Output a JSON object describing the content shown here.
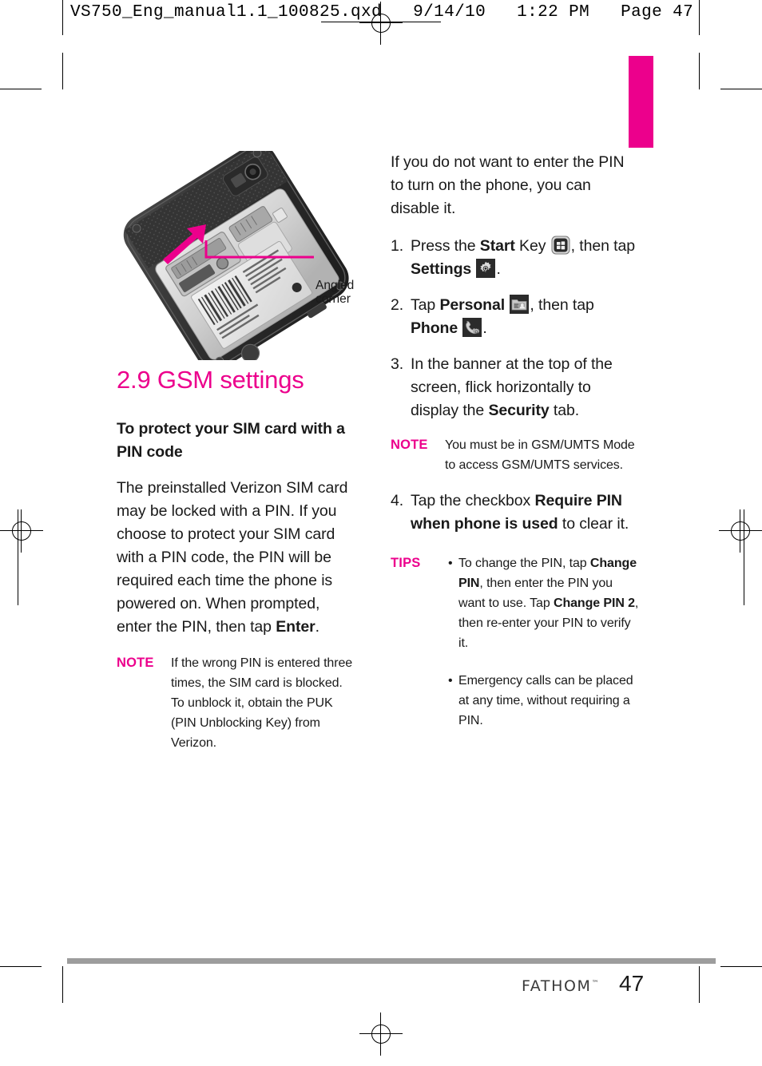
{
  "print_header": {
    "text": "VS750_Eng_manual1.1_100825.qxd   9/14/10   1:22 PM   Page 47"
  },
  "colors": {
    "accent": "#EC008C",
    "text": "#1A1A1A",
    "rule": "#9D9D9D"
  },
  "figure": {
    "alt_name": "phone-back-cover-removed-sim-slot",
    "callout_line1": "Angled",
    "callout_line2": "corner"
  },
  "left_column": {
    "section_title": "2.9 GSM settings",
    "sub_title": "To protect your SIM card with a PIN code",
    "paragraph_parts": {
      "p1_a": "The preinstalled Verizon SIM card may be locked with a PIN. If you choose to protect your SIM card with a PIN code, the PIN will be required each time the phone is powered on. When prompted, enter the PIN, then tap ",
      "p1_bold": "Enter",
      "p1_b": "."
    },
    "note": {
      "tag": "NOTE",
      "text": "If the wrong PIN is entered three times, the SIM card is blocked. To unblock it, obtain the PUK (PIN Unblocking Key) from Verizon."
    }
  },
  "right_column": {
    "intro": "If you do not want to enter the PIN to turn on the phone, you can disable it.",
    "steps": [
      {
        "num": "1.",
        "a": "Press the ",
        "bold1": "Start",
        "b": " Key ",
        "icon1": "start-key-icon",
        "c": ", then tap ",
        "bold2": "Settings",
        "icon2": "settings-gear-icon",
        "d": "."
      },
      {
        "num": "2.",
        "a": "Tap ",
        "bold1": "Personal",
        "icon1": "personal-folder-icon",
        "b": ", then tap ",
        "bold2": "Phone",
        "icon2": "phone-settings-icon",
        "c": "."
      },
      {
        "num": "3.",
        "a": "In the banner at the top of the screen, flick horizontally to display the ",
        "bold1": "Security",
        "b": " tab."
      },
      {
        "num": "4.",
        "a": "Tap the checkbox ",
        "bold1": "Require PIN when phone is used",
        "b": " to clear it."
      }
    ],
    "note": {
      "tag": "NOTE",
      "text": "You must be in GSM/UMTS Mode to access GSM/UMTS services."
    },
    "tips": {
      "tag": "TIPS",
      "bullets": [
        {
          "dot": "•",
          "a": "To change the PIN, tap ",
          "bold1": "Change PIN",
          "b": ", then enter the PIN you want to use. Tap ",
          "bold2": "Change PIN 2",
          "c": ", then re-enter your PIN to verify it."
        },
        {
          "dot": "•",
          "a": "Emergency calls can be placed at any time, without requiring a PIN."
        }
      ]
    }
  },
  "footer": {
    "brand": "FATHOM",
    "trademark": "™",
    "page_number": "47"
  }
}
